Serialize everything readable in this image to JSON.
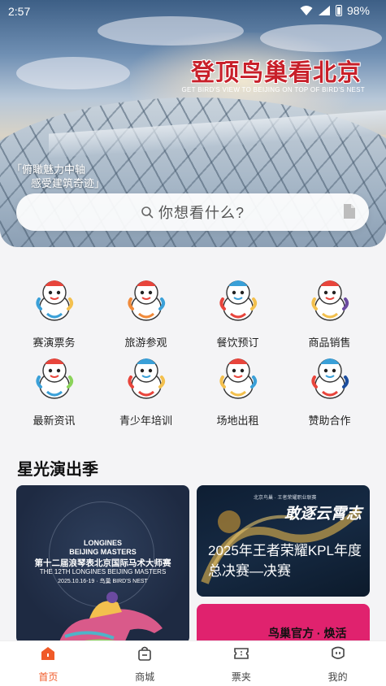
{
  "status_bar": {
    "time": "2:57",
    "battery": "98%"
  },
  "hero": {
    "title": "登顶鸟巢看北京",
    "subtitle": "GET BIRD'S VIEW TO BEIJING ON TOP OF BIRD'S NEST",
    "slogan_line1": "「俯瞰魅力中轴",
    "slogan_line2": "感受建筑奇迹」"
  },
  "search": {
    "placeholder": "你想看什么?"
  },
  "categories": [
    {
      "label": "赛演票务",
      "icon": "mascot-ticket-icon"
    },
    {
      "label": "旅游参观",
      "icon": "mascot-tour-icon"
    },
    {
      "label": "餐饮预订",
      "icon": "mascot-dining-icon"
    },
    {
      "label": "商品销售",
      "icon": "mascot-shop-icon"
    },
    {
      "label": "最新资讯",
      "icon": "mascot-news-icon"
    },
    {
      "label": "青少年培训",
      "icon": "mascot-training-icon"
    },
    {
      "label": "场地出租",
      "icon": "mascot-venue-icon"
    },
    {
      "label": "赞助合作",
      "icon": "mascot-sponsor-icon"
    }
  ],
  "section": {
    "title": "星光演出季",
    "cards": [
      {
        "brand_line1": "LONGINES",
        "brand_line2": "BEIJING MASTERS",
        "title_cn": "第十二届浪琴表北京国际马术大师赛",
        "title_en": "THE 12TH LONGINES BEIJING MASTERS",
        "date": "2025.10.16-19 · 鸟巢 BIRD'S NEST"
      },
      {
        "tag": "北京鸟巢 · 王者荣耀职业联赛",
        "logo": "敢逐云霄志",
        "caption": "2025年王者荣耀KPL年度总决赛—决赛"
      },
      {
        "title": "鸟巢官方 · 焕活"
      }
    ]
  },
  "tabbar": [
    {
      "label": "首页",
      "icon": "home-icon",
      "active": true
    },
    {
      "label": "商城",
      "icon": "shopping-bag-icon",
      "active": false
    },
    {
      "label": "票夹",
      "icon": "ticket-icon",
      "active": false
    },
    {
      "label": "我的",
      "icon": "profile-icon",
      "active": false
    }
  ],
  "colors": {
    "accent": "#f05a28",
    "hero_title": "#c8202a",
    "card_pink": "#e0226e"
  }
}
